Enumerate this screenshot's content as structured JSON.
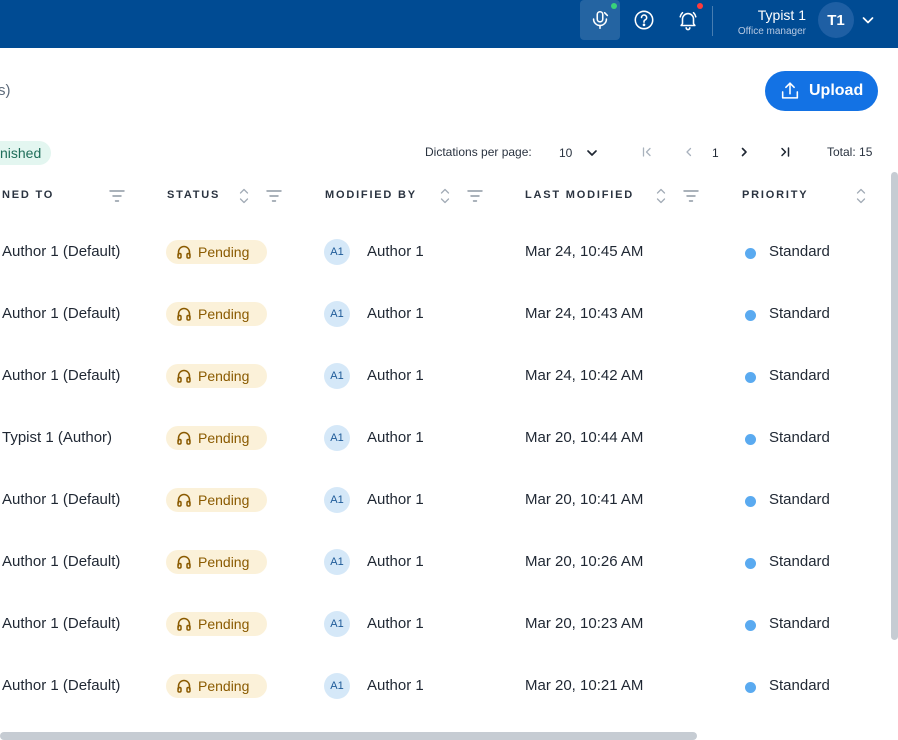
{
  "user": {
    "name": "Typist 1",
    "role": "Office manager",
    "initials": "T1"
  },
  "toolbar": {
    "partial_text": "s)",
    "upload_label": "Upload"
  },
  "filter_chip": {
    "label": "nished"
  },
  "pagination": {
    "per_page_label": "Dictations per page:",
    "per_page_value": "10",
    "current_page": "1",
    "total_label": "Total: 15"
  },
  "columns": {
    "assigned_to": "NED TO",
    "status": "STATUS",
    "modified_by": "MODIFIED BY",
    "last_modified": "LAST MODIFIED",
    "priority": "PRIORITY"
  },
  "colors": {
    "topbar": "#004b93",
    "accent": "#1372e4",
    "pending_bg": "#fbf1d9",
    "pending_text": "#8a5a00",
    "priority_standard": "#5aaaf0"
  },
  "icons": {
    "topbar": [
      "microphone-icon",
      "help-icon",
      "bell-icon",
      "chevron-down-icon"
    ],
    "upload": "upload-icon",
    "status": "headphones-icon",
    "sort": "sort-icon",
    "filter": "filter-icon"
  },
  "rows": [
    {
      "assigned_to": "Author 1 (Default)",
      "status": "Pending",
      "modified_by_initials": "A1",
      "modified_by": "Author 1",
      "last_modified": "Mar 24, 10:45 AM",
      "priority": "Standard"
    },
    {
      "assigned_to": "Author 1 (Default)",
      "status": "Pending",
      "modified_by_initials": "A1",
      "modified_by": "Author 1",
      "last_modified": "Mar 24, 10:43 AM",
      "priority": "Standard"
    },
    {
      "assigned_to": "Author 1 (Default)",
      "status": "Pending",
      "modified_by_initials": "A1",
      "modified_by": "Author 1",
      "last_modified": "Mar 24, 10:42 AM",
      "priority": "Standard"
    },
    {
      "assigned_to": "Typist 1 (Author)",
      "status": "Pending",
      "modified_by_initials": "A1",
      "modified_by": "Author 1",
      "last_modified": "Mar 20, 10:44 AM",
      "priority": "Standard"
    },
    {
      "assigned_to": "Author 1 (Default)",
      "status": "Pending",
      "modified_by_initials": "A1",
      "modified_by": "Author 1",
      "last_modified": "Mar 20, 10:41 AM",
      "priority": "Standard"
    },
    {
      "assigned_to": "Author 1 (Default)",
      "status": "Pending",
      "modified_by_initials": "A1",
      "modified_by": "Author 1",
      "last_modified": "Mar 20, 10:26 AM",
      "priority": "Standard"
    },
    {
      "assigned_to": "Author 1 (Default)",
      "status": "Pending",
      "modified_by_initials": "A1",
      "modified_by": "Author 1",
      "last_modified": "Mar 20, 10:23 AM",
      "priority": "Standard"
    },
    {
      "assigned_to": "Author 1 (Default)",
      "status": "Pending",
      "modified_by_initials": "A1",
      "modified_by": "Author 1",
      "last_modified": "Mar 20, 10:21 AM",
      "priority": "Standard"
    }
  ]
}
